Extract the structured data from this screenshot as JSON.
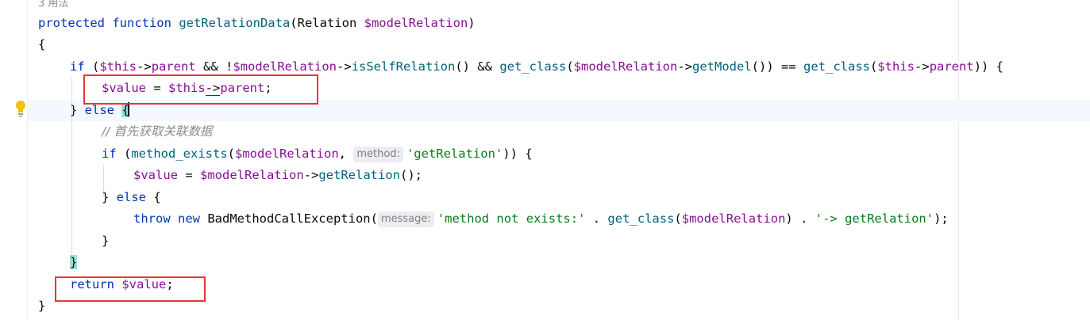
{
  "editor": {
    "usages_hint": "3 用法",
    "colors": {
      "keyword": "#0033b3",
      "variable": "#871094",
      "function": "#00627a",
      "string": "#067d17",
      "comment": "#8c8c8c",
      "highlight_box": "#e53935"
    },
    "lines": {
      "l1": {
        "kw": "protected function ",
        "fn": "getRelationData",
        "p1": "(Relation ",
        "var": "$modelRelation",
        "p2": ")"
      },
      "l2": {
        "t": "{"
      },
      "l3": {
        "kw": "if",
        "a": " (",
        "this1": "$this",
        "arr1": "->",
        "parent1": "parent",
        "b": " && !",
        "mr1": "$modelRelation",
        "c": "->",
        "m1": "isSelfRelation",
        "d": "() && ",
        "gc1": "get_class",
        "e": "(",
        "mr2": "$modelRelation",
        "f": "->",
        "m2": "getModel",
        "g": "()) == ",
        "gc2": "get_class",
        "h": "(",
        "this2": "$this",
        "i": "->",
        "parent2": "parent",
        "j": ")) {"
      },
      "l4": {
        "val": "$value",
        "a": " = ",
        "this": "$this",
        "arr": "->",
        "parent": "parent",
        "b": ";"
      },
      "l5": {
        "a": "} ",
        "kw": "else",
        "b": " ",
        "brace": "{"
      },
      "l6": {
        "cmt": "// 首先获取关联数据"
      },
      "l7": {
        "kw": "if",
        "a": " (",
        "fn": "method_exists",
        "b": "(",
        "mr": "$modelRelation",
        "c": ", ",
        "hint": "method:",
        "str": "'getRelation'",
        "d": ")) {"
      },
      "l8": {
        "val": "$value",
        "a": " = ",
        "mr": "$modelRelation",
        "b": "->",
        "m": "getRelation",
        "c": "();"
      },
      "l9": {
        "a": "} ",
        "kw": "else",
        "b": " {"
      },
      "l10": {
        "kw": "throw new ",
        "cls": "BadMethodCallException(",
        "hint": "message:",
        "str1": "'method not exists:'",
        "a": " . ",
        "gc": "get_class",
        "b": "(",
        "mr": "$modelRelation",
        "c": ") . ",
        "str2": "'-> getRelation'",
        "d": ");"
      },
      "l11": {
        "t": "}"
      },
      "l12": {
        "brace": "}"
      },
      "l13": {
        "kw": "return ",
        "val": "$value",
        "a": ";"
      },
      "l14": {
        "t": "}"
      }
    }
  }
}
